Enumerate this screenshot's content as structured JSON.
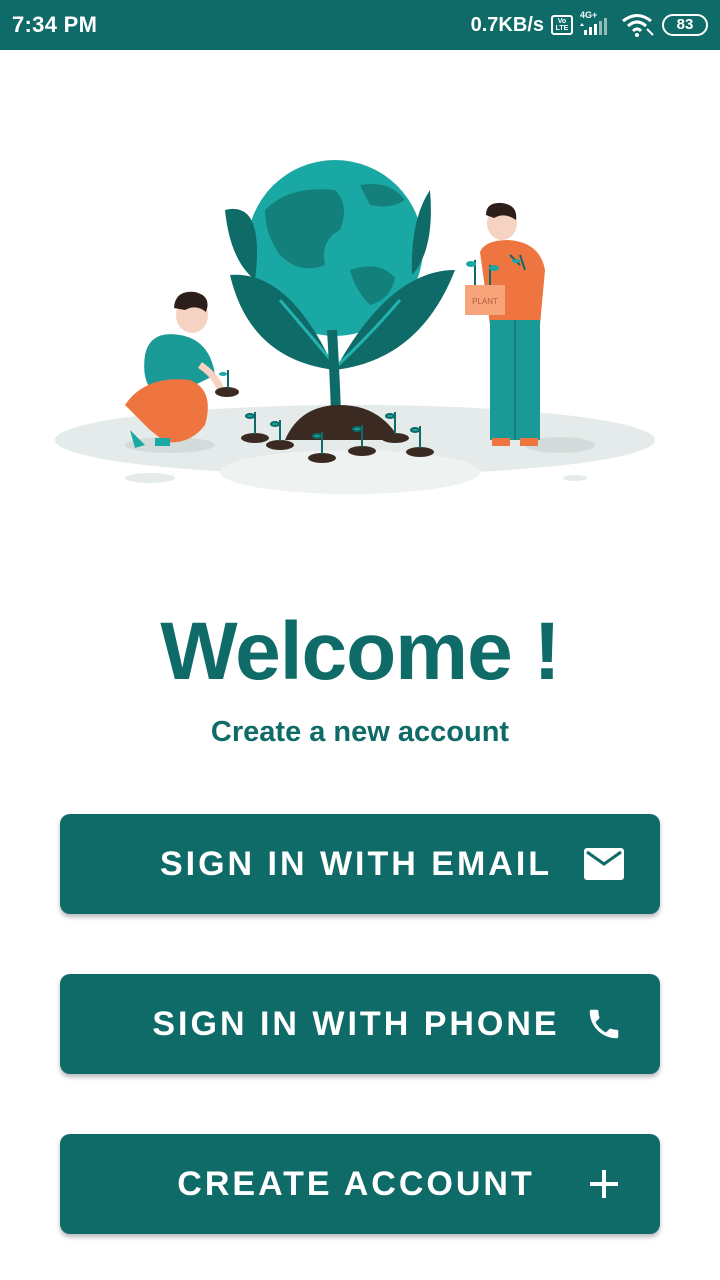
{
  "status_bar": {
    "time": "7:34 PM",
    "net_speed": "0.7KB/s",
    "volte_top": "Vo",
    "volte_bottom": "LTE",
    "network": "4G+",
    "battery": "83"
  },
  "illustration": {
    "box_label": "PLANT"
  },
  "welcome": {
    "title": "Welcome !",
    "subtitle": "Create a new account"
  },
  "buttons": {
    "email": {
      "label": "SIGN IN WITH EMAIL",
      "icon": "mail-icon"
    },
    "phone": {
      "label": "SIGN IN WITH PHONE",
      "icon": "phone-icon"
    },
    "create": {
      "label": "CREATE ACCOUNT",
      "icon": "plus-icon"
    }
  },
  "colors": {
    "primary": "#0f6b67",
    "accent_orange": "#ef7540",
    "globe_teal": "#1aa8a4",
    "soil": "#3a2a22"
  }
}
